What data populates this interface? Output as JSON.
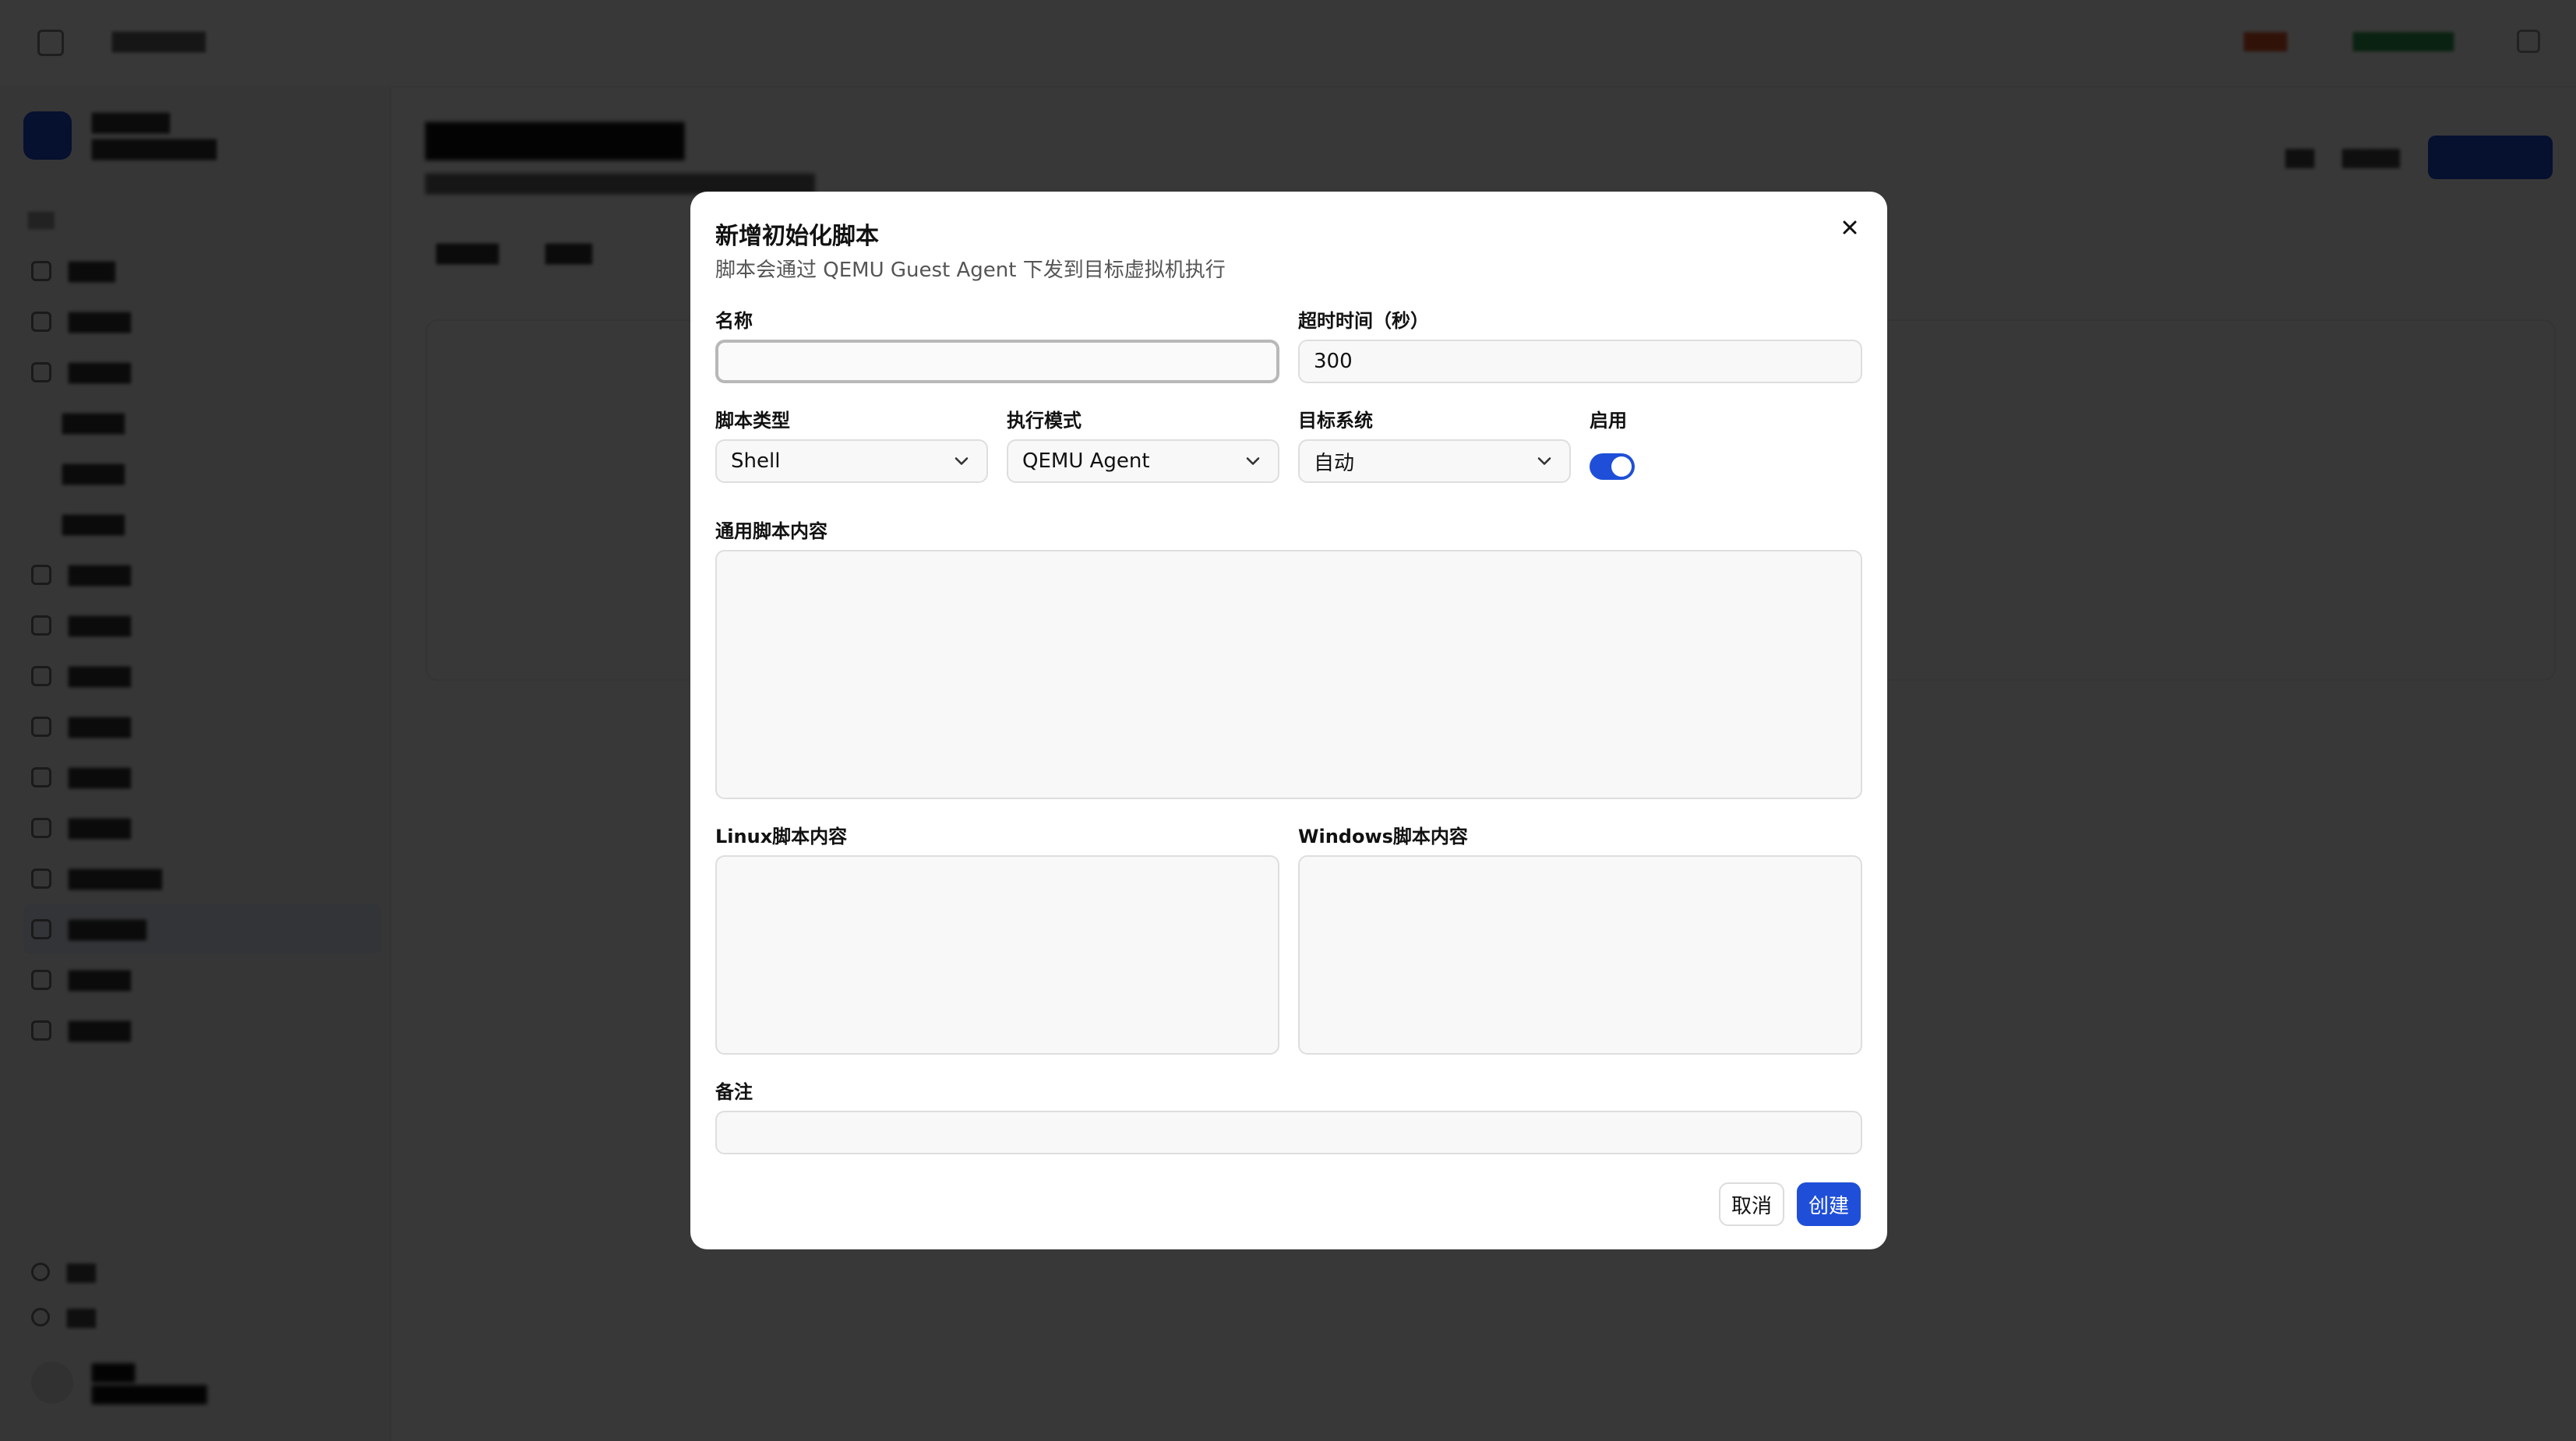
{
  "modal": {
    "title": "新增初始化脚本",
    "subtitle": "脚本会通过 QEMU Guest Agent 下发到目标虚拟机执行",
    "fields": {
      "name_label": "名称",
      "name_value": "",
      "timeout_label": "超时时间（秒）",
      "timeout_value": "300",
      "script_type_label": "脚本类型",
      "script_type_value": "Shell",
      "exec_mode_label": "执行模式",
      "exec_mode_value": "QEMU Agent",
      "target_os_label": "目标系统",
      "target_os_value": "自动",
      "enabled_label": "启用",
      "enabled": true,
      "common_script_label": "通用脚本内容",
      "linux_script_label": "Linux脚本内容",
      "windows_script_label": "Windows脚本内容",
      "remark_label": "备注",
      "remark_value": ""
    },
    "buttons": {
      "cancel": "取消",
      "create": "创建"
    },
    "icons": {
      "close": "close-icon",
      "select_chevron": "chevron-down-icon"
    }
  },
  "colors": {
    "accent": "#1f4fd8",
    "overlay": "rgba(0,0,0,0.78)",
    "field_bg": "#f8f8f8",
    "border": "#dedede"
  }
}
